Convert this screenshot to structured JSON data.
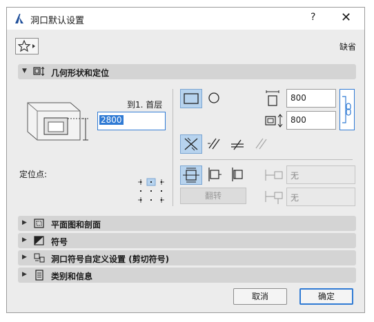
{
  "window": {
    "title": "洞口默认设置",
    "help_label": "?",
    "close_label": "✕"
  },
  "toolbar": {
    "default_label": "缺省"
  },
  "sections": {
    "geometry": "几何形状和定位",
    "plan_section": "平面图和剖面",
    "symbol": "符号",
    "custom_symbol": "洞口符号自定义设置 (剪切符号)",
    "classification": "类别和信息"
  },
  "geometry": {
    "floor_label": "到1. 首层",
    "height_value": "2800",
    "anchor_label": "定位点:",
    "width_value": "800",
    "depth_value": "800",
    "field_a": "无",
    "field_b": "无",
    "flip_label": "翻转"
  },
  "buttons": {
    "cancel": "取消",
    "ok": "确定"
  },
  "colors": {
    "accent": "#2f7ad4",
    "selected_bg": "#b7d3ee",
    "section_bg": "#d4d4d4"
  }
}
